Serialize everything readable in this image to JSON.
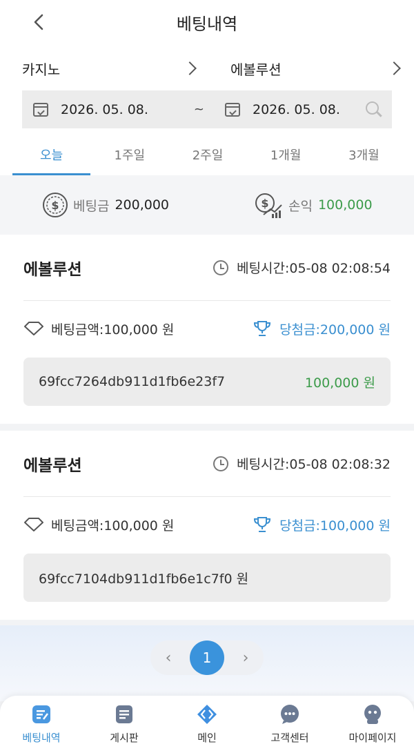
{
  "header": {
    "title": "베팅내역"
  },
  "filters": {
    "category": "카지노",
    "game": "에볼루션",
    "date_from": "2026. 05. 08.",
    "date_separator": "~",
    "date_to": "2026. 05. 08.",
    "tabs": [
      {
        "label": "오늘",
        "active": true
      },
      {
        "label": "1주일",
        "active": false
      },
      {
        "label": "2주일",
        "active": false
      },
      {
        "label": "1개월",
        "active": false
      },
      {
        "label": "3개월",
        "active": false
      }
    ]
  },
  "summary": {
    "bet_label": "베팅금",
    "bet_value": "200,000",
    "profit_label": "손익",
    "profit_value": "100,000"
  },
  "records": [
    {
      "game": "에볼루션",
      "time": "베팅시간:05-08 02:08:54",
      "bet": "베팅금액:100,000 원",
      "win": "당첨금:200,000 원",
      "hash": "69fcc7264db911d1fb6e23f7",
      "payout": "100,000 원"
    },
    {
      "game": "에볼루션",
      "time": "베팅시간:05-08 02:08:32",
      "bet": "베팅금액:100,000 원",
      "win": "당첨금:100,000 원",
      "hash": "69fcc7104db911d1fb6e1c7f0 원",
      "payout": ""
    }
  ],
  "pagination": {
    "prev": "‹",
    "current": "1",
    "next": "›"
  },
  "bottom_nav": [
    {
      "label": "베팅내역",
      "icon": "bet-history-icon",
      "active": true
    },
    {
      "label": "게시판",
      "icon": "board-icon",
      "active": false
    },
    {
      "label": "메인",
      "icon": "main-icon",
      "active": false
    },
    {
      "label": "고객센터",
      "icon": "chat-icon",
      "active": false
    },
    {
      "label": "마이페이지",
      "icon": "mypage-icon",
      "active": false
    }
  ],
  "colors": {
    "accent": "#3a8fd0",
    "profit": "#3c9b4a",
    "page_button": "#3a93dc"
  }
}
